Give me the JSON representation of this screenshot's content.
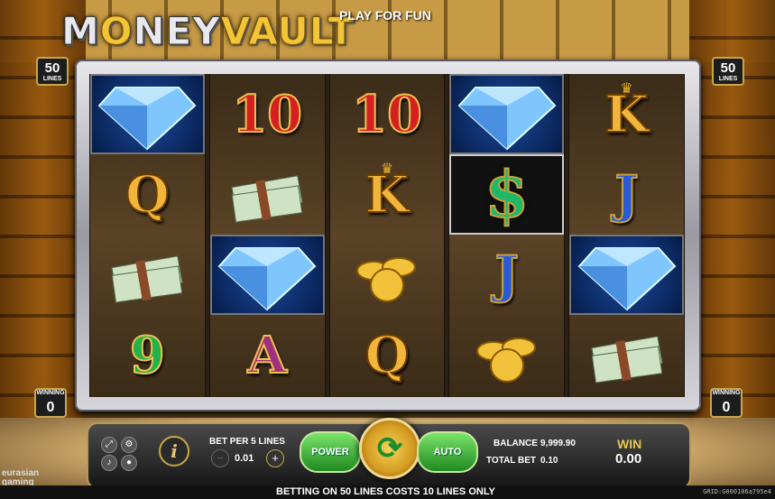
{
  "game": {
    "logo_part1": "M",
    "logo_o": "O",
    "logo_part2": "NEY",
    "logo_part3": "VAULT",
    "play_mode": "PLAY FOR FUN"
  },
  "side": {
    "lines_value": "50",
    "lines_label": "LINES",
    "winning_label": "WINNING",
    "winning_value": "0"
  },
  "reels": [
    [
      "diamond",
      "Q",
      "cash",
      "9"
    ],
    [
      "10",
      "cash",
      "diamond",
      "A"
    ],
    [
      "10",
      "K",
      "coins",
      "Q"
    ],
    [
      "diamond",
      "$",
      "J",
      "coins"
    ],
    [
      "K",
      "J",
      "diamond",
      "cash"
    ]
  ],
  "symbols": {
    "nine": "9",
    "ten": "10",
    "j": "J",
    "q": "Q",
    "k": "K",
    "a": "A",
    "dollar": "$"
  },
  "controls": {
    "bet_label": "BET PER 5 LINES",
    "bet_value": "0.01",
    "minus": "−",
    "plus": "+",
    "power_label": "POWER",
    "auto_label": "AUTO",
    "spin_glyph": "⟳",
    "balance_label": "BALANCE",
    "balance_value": "9,999.90",
    "total_bet_label": "TOTAL BET",
    "total_bet_value": "0.10",
    "win_label": "WIN",
    "win_value": "0.00",
    "info_glyph": "i"
  },
  "footer": {
    "message": "BETTING ON 50 LINES COSTS 10 LINES ONLY",
    "grid_id": "GRID:G000106a795e4",
    "brand_line1": "eurasian",
    "brand_line2": "gaming"
  },
  "colors": {
    "accent_gold": "#c9a64a",
    "button_green": "#1f8a20",
    "win_gold": "#e8c64a"
  }
}
